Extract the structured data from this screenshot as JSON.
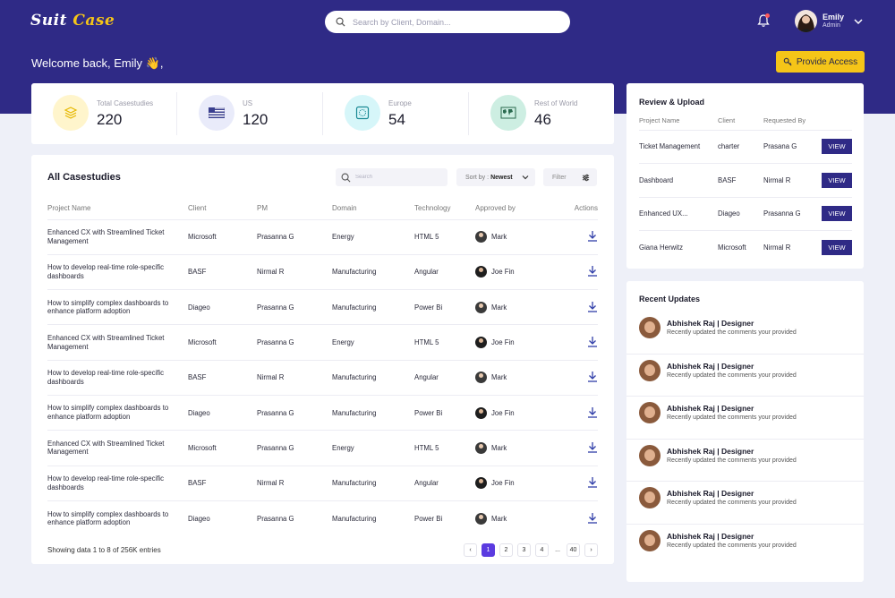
{
  "header": {
    "logo_part1": "Suit",
    "logo_part2": "Case",
    "search_placeholder": "Search by Client, Domain...",
    "user_name": "Emily",
    "user_role": "Admin"
  },
  "welcome": "Welcome back, Emily 👋,",
  "provide_access_label": "Provide Access",
  "stats": [
    {
      "label": "Total Casestudies",
      "value": "220",
      "icon": "layers-icon",
      "color": "#fff5cc"
    },
    {
      "label": "US",
      "value": "120",
      "icon": "us-flag-icon",
      "color": "#e9ebfa"
    },
    {
      "label": "Europe",
      "value": "54",
      "icon": "eu-flag-icon",
      "color": "#d6f6f9"
    },
    {
      "label": "Rest of World",
      "value": "46",
      "icon": "world-map-icon",
      "color": "#cdeee2"
    }
  ],
  "casestudies": {
    "title": "All Casestudies",
    "search_placeholder": "Search",
    "sort_prefix": "Sort by :",
    "sort_value": "Newest",
    "filter_label": "Filter",
    "columns": [
      "Project Name",
      "Client",
      "PM",
      "Domain",
      "Technology",
      "Approved by",
      "Actions"
    ],
    "rows": [
      {
        "project": "Enhanced CX with Streamlined Ticket Management",
        "client": "Microsoft",
        "pm": "Prasanna G",
        "domain": "Energy",
        "tech": "HTML 5",
        "approved": "Mark"
      },
      {
        "project": "How to develop real-time role-specific dashboards",
        "client": "BASF",
        "pm": "Nirmal R",
        "domain": "Manufacturing",
        "tech": "Angular",
        "approved": "Joe Fin"
      },
      {
        "project": "How to simplify complex dashboards to enhance platform adoption",
        "client": "Diageo",
        "pm": "Prasanna G",
        "domain": "Manufacturing",
        "tech": "Power Bi",
        "approved": "Mark"
      },
      {
        "project": "Enhanced CX with Streamlined Ticket Management",
        "client": "Microsoft",
        "pm": "Prasanna G",
        "domain": "Energy",
        "tech": "HTML 5",
        "approved": "Joe Fin"
      },
      {
        "project": "How to develop real-time role-specific dashboards",
        "client": "BASF",
        "pm": "Nirmal R",
        "domain": "Manufacturing",
        "tech": "Angular",
        "approved": "Mark"
      },
      {
        "project": "How to simplify complex dashboards to enhance platform adoption",
        "client": "Diageo",
        "pm": "Prasanna G",
        "domain": "Manufacturing",
        "tech": "Power Bi",
        "approved": "Joe Fin"
      },
      {
        "project": "Enhanced CX with Streamlined Ticket Management",
        "client": "Microsoft",
        "pm": "Prasanna G",
        "domain": "Energy",
        "tech": "HTML 5",
        "approved": "Mark"
      },
      {
        "project": "How to develop real-time role-specific dashboards",
        "client": "BASF",
        "pm": "Nirmal R",
        "domain": "Manufacturing",
        "tech": "Angular",
        "approved": "Joe Fin"
      },
      {
        "project": "How to simplify complex dashboards to enhance platform adoption",
        "client": "Diageo",
        "pm": "Prasanna G",
        "domain": "Manufacturing",
        "tech": "Power Bi",
        "approved": "Mark"
      }
    ],
    "footer": "Showing data 1 to 8 of  256K entries",
    "pagination": [
      "‹",
      "1",
      "2",
      "3",
      "4",
      "...",
      "40",
      "›"
    ],
    "active_page": "1"
  },
  "review": {
    "title": "Review & Upload",
    "columns": [
      "Project Name",
      "Client",
      "Requested By"
    ],
    "view_label": "VIEW",
    "rows": [
      {
        "project": "Ticket Management",
        "client": "charter",
        "requested": "Prasana G"
      },
      {
        "project": "Dashboard",
        "client": "BASF",
        "requested": "Nirmal R"
      },
      {
        "project": "Enhanced UX...",
        "client": "Diageo",
        "requested": "Prasanna G"
      },
      {
        "project": "Giana Herwitz",
        "client": "Microsoft",
        "requested": "Nirmal R"
      }
    ]
  },
  "updates": {
    "title": "Recent Updates",
    "items": [
      {
        "name": "Abhishek Raj | Designer",
        "message": "Recently updated the comments your provided"
      },
      {
        "name": "Abhishek Raj | Designer",
        "message": "Recently updated the comments your provided"
      },
      {
        "name": "Abhishek Raj | Designer",
        "message": "Recently updated the comments your provided"
      },
      {
        "name": "Abhishek Raj | Designer",
        "message": "Recently updated the comments your provided"
      },
      {
        "name": "Abhishek Raj | Designer",
        "message": "Recently updated the comments your provided"
      },
      {
        "name": "Abhishek Raj | Designer",
        "message": "Recently updated the comments your provided"
      }
    ]
  },
  "colors": {
    "brand": "#2f2a86",
    "accent": "#f5c518",
    "active_page": "#5b3be0"
  }
}
